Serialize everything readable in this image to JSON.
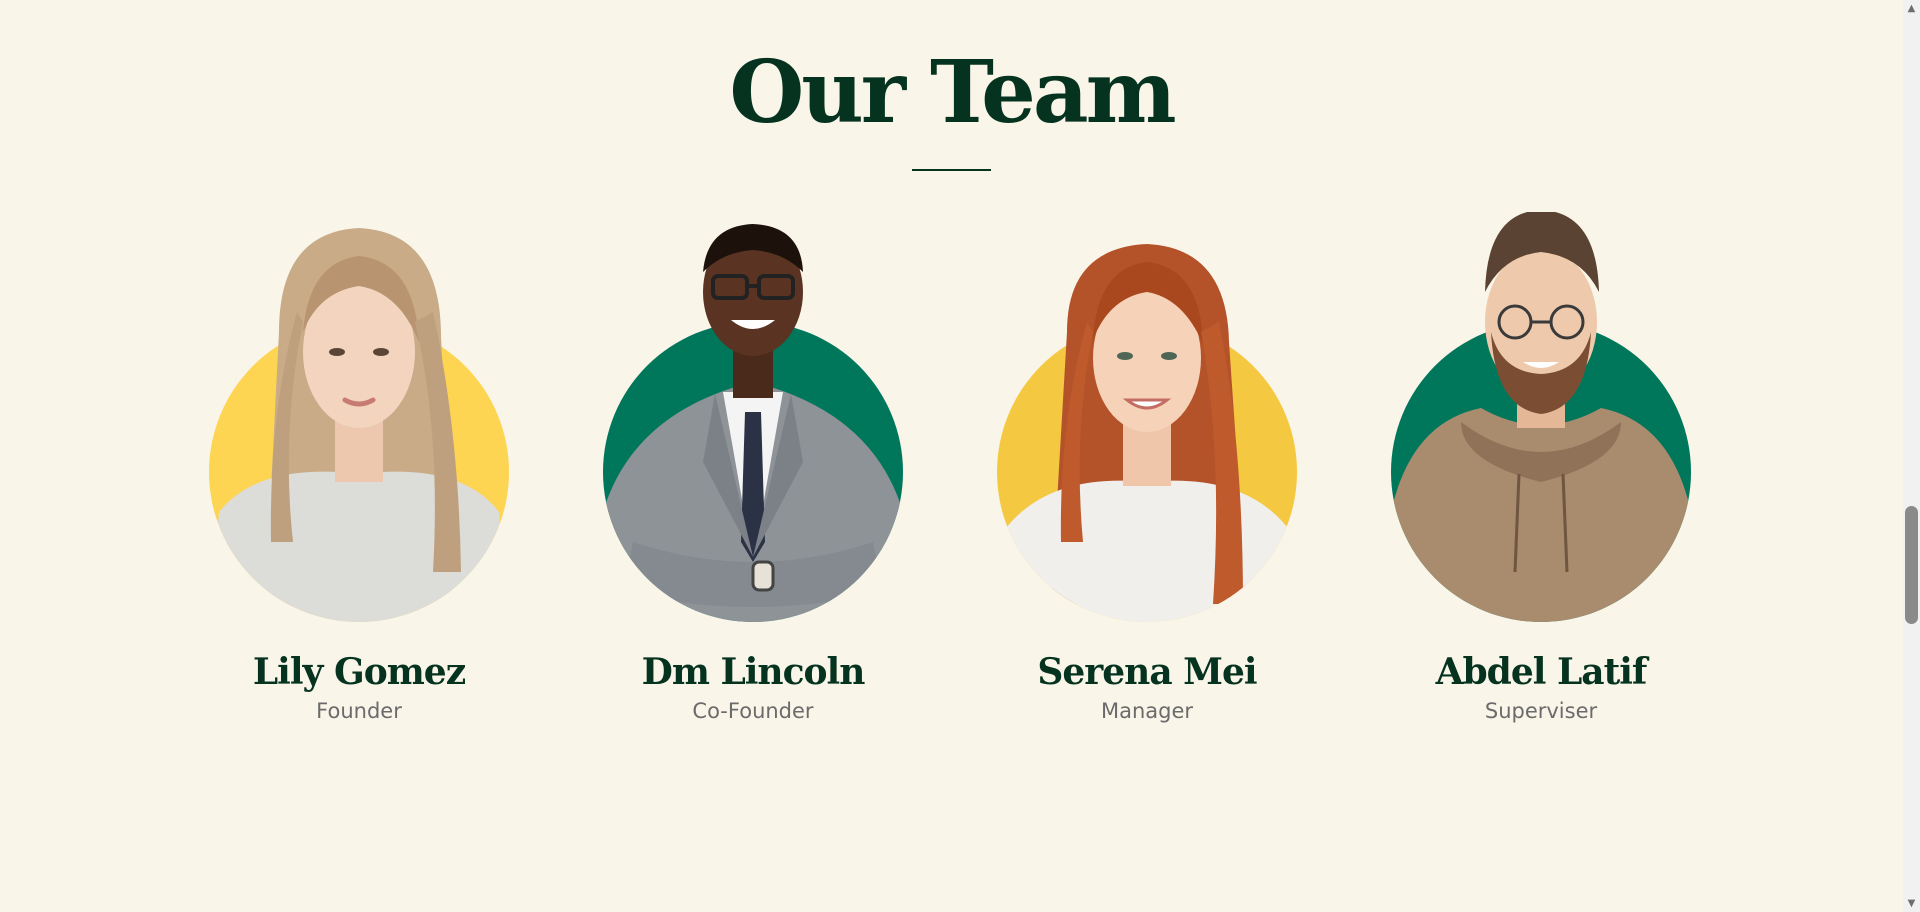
{
  "section": {
    "title": "Our Team"
  },
  "members": [
    {
      "name": "Lily Gomez",
      "role": "Founder",
      "backdrop_color": "#fdd552",
      "photo": "woman-long-blonde-hair-gray-sweater"
    },
    {
      "name": "Dm Lincoln",
      "role": "Co-Founder",
      "backdrop_color": "#00765b",
      "photo": "man-glasses-gray-suit-tie-arms-crossed"
    },
    {
      "name": "Serena Mei",
      "role": "Manager",
      "backdrop_color": "#f5c842",
      "photo": "woman-long-red-hair-white-shirt"
    },
    {
      "name": "Abdel Latif",
      "role": "Superviser",
      "backdrop_color": "#00765b",
      "photo": "man-glasses-beard-brown-hoodie"
    }
  ],
  "colors": {
    "background": "#f9f5e9",
    "heading": "#05331f",
    "role_text": "#6b6b6b"
  },
  "scrollbar": {
    "up_icon": "▲",
    "down_icon": "▼"
  }
}
